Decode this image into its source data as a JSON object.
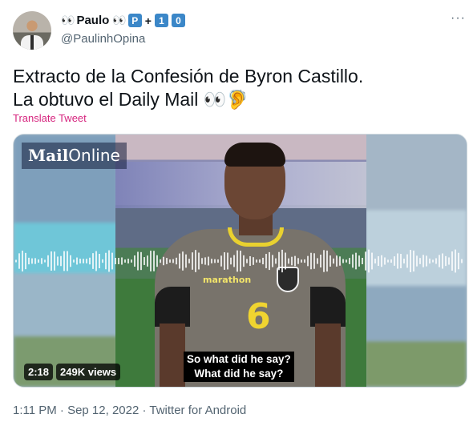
{
  "author": {
    "display_name_prefix_emoji": "👀",
    "display_name": "Paulo",
    "display_name_suffix_emoji": "👀",
    "badges": [
      "P",
      "+",
      "1",
      "0"
    ],
    "handle": "@PaulinhOpina",
    "avatar_icon": "user-avatar-photo"
  },
  "more_icon": "···",
  "tweet": {
    "line1": "Extracto de la Confesión de Byron Castillo.",
    "line2": "La obtuvo el Daily Mail 👀🦻",
    "translate": "Translate Tweet"
  },
  "video": {
    "logo_bold": "Mail",
    "logo_thin": "Online",
    "jersey_sponsor": "marathon",
    "jersey_number": "6",
    "subtitle_line1": "So what did he say?",
    "subtitle_line2": "What did he say?",
    "duration": "2:18",
    "views": "249K views"
  },
  "meta": {
    "timestamp": "1:11 PM · Sep 12, 2022 · Twitter for Android"
  },
  "colors": {
    "badge_blue": "#3b87c8",
    "translate_pink": "#d6247e",
    "muted_text": "#536471"
  }
}
